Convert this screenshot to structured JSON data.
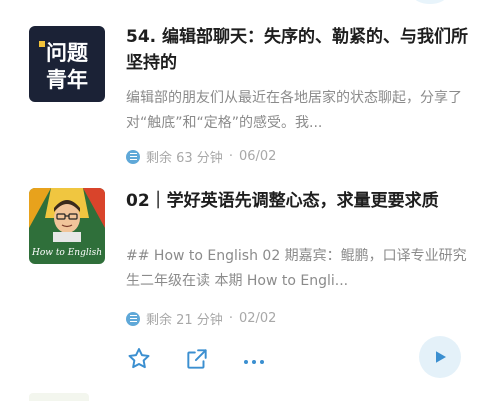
{
  "colors": {
    "title": "#1e1e1e",
    "description": "#8b8b8b",
    "meta": "#a8a8a8",
    "accent": "#3b8fd0",
    "play_bg": "#e4f1f9"
  },
  "episodes": [
    {
      "cover": {
        "logo_text": "问题青年",
        "logo_line1": "问题",
        "logo_line2": "青年",
        "bg": "#1b2236"
      },
      "title": "54. 编辑部聊天：失序的、勒紧的、与我们所坚持的",
      "description": "编辑部的朋友们从最近在各地居家的状态聊起，分享了对“触底”和“定格”的感受。我...",
      "remaining": "剩余 63 分钟",
      "separator": "·",
      "date": "06/02",
      "icon": "progress-icon"
    },
    {
      "cover": {
        "logo_text": "How to English",
        "bg": "#2f6f3a"
      },
      "title": "02｜学好英语先调整心态，求量更要求质",
      "description": "## How to English 02 期嘉宾：鲲鹏，口译专业研究生二年级在读 本期 How to Engli...",
      "remaining": "剩余 21 分钟",
      "separator": "·",
      "date": "02/02",
      "icon": "progress-icon",
      "actions": [
        {
          "name": "favorite",
          "icon": "star-icon"
        },
        {
          "name": "share",
          "icon": "share-icon"
        },
        {
          "name": "more",
          "icon": "more-icon"
        },
        {
          "name": "play",
          "icon": "play-icon"
        }
      ]
    }
  ]
}
